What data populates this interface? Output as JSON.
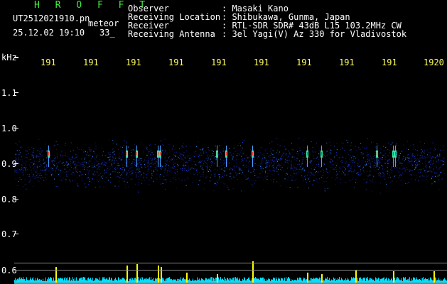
{
  "header": {
    "title": "H R O F F T",
    "filename": "UT2512021910.pn",
    "meteor_label": "meteor",
    "datetime": "25.12.02 19:10",
    "count": "33_",
    "fields": [
      {
        "label": "Observer",
        "value": ": Masaki Kano"
      },
      {
        "label": "Receiving Location",
        "value": ": Shibukawa, Gunma, Japan"
      },
      {
        "label": "Receiver",
        "value": ": RTL-SDR SDR# 43dB L15 103.2MHz CW"
      },
      {
        "label": "Receiving Antenna",
        "value": ": 3el Yagi(V) Az 330 for Vladivostok"
      }
    ]
  },
  "axes": {
    "y_unit": "kHz",
    "y_ticks": [
      "1.1",
      "1.0",
      "0.9",
      "0.8",
      "0.7",
      "0.6"
    ],
    "x_ticks": [
      "191",
      "191",
      "191",
      "191",
      "191",
      "191",
      "191",
      "191",
      "191",
      "1920"
    ]
  },
  "colors": {
    "background": "#000000",
    "text": "#ffffff",
    "title": "#3cf03c",
    "time_labels": "#ffff60",
    "echo_bar": "#ffff00",
    "noise_floor": "#00e0ff"
  }
}
